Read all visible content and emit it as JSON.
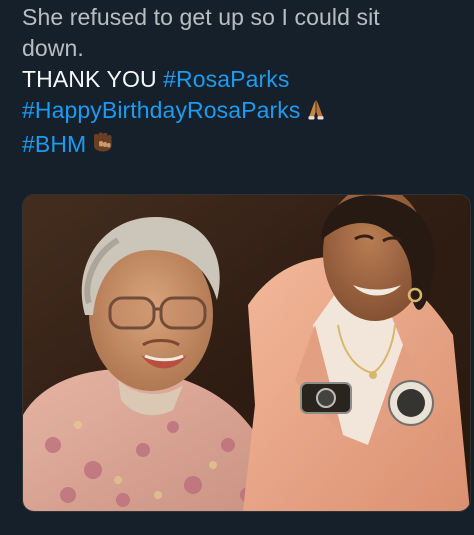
{
  "tweet": {
    "line1": "She refused to get up so I could sit",
    "line2": "down.",
    "thank_you": "THANK YOU ",
    "hashtag_rosaparks": "#RosaParks",
    "hashtag_birthday": "#HappyBirthdayRosaParks",
    "hashtag_bhm": "#BHM",
    "emoji_1": "folded-hands-emoji",
    "emoji_2": "raised-fist-emoji"
  },
  "media": {
    "type": "photo",
    "subject": "vintage-photo"
  },
  "colors": {
    "background": "#15202b",
    "text": "#e7e9ea",
    "hashtag": "#1d9bf0"
  }
}
